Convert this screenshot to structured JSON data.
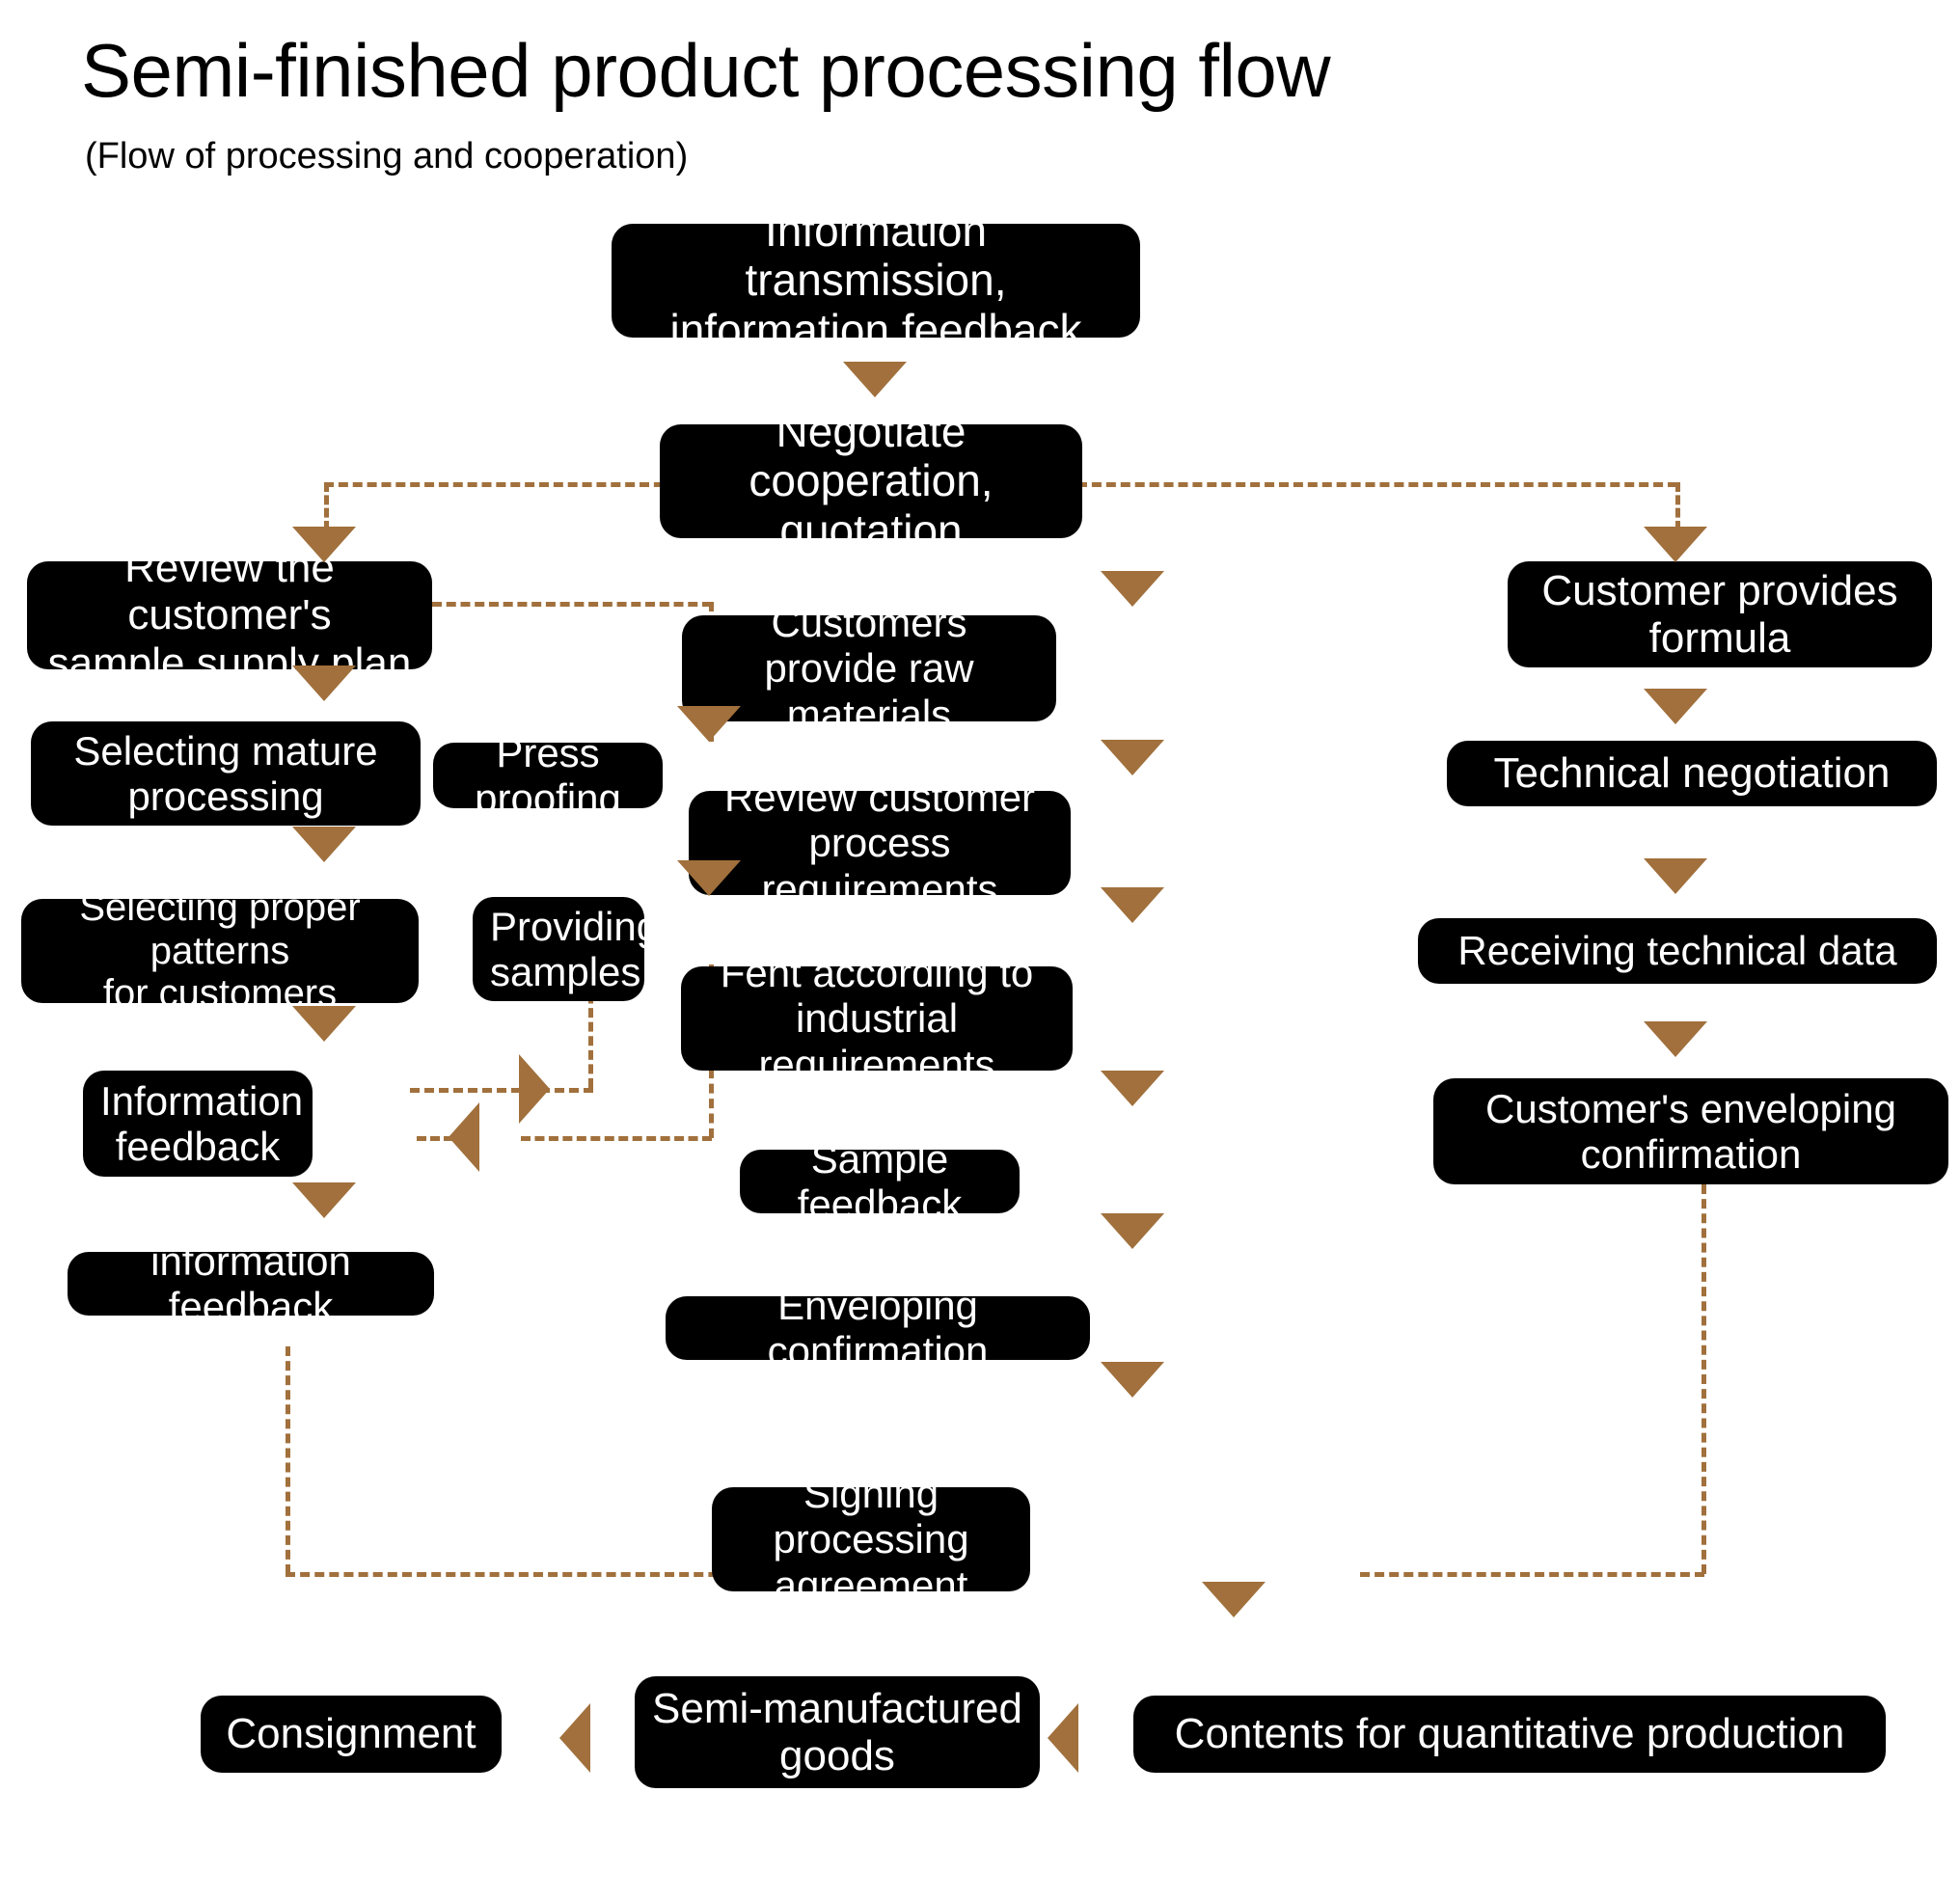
{
  "title": "Semi-finished product processing flow",
  "subtitle": "(Flow of processing and cooperation)",
  "colors": {
    "node_fill": "#000000",
    "node_text": "#ffffff",
    "connector": "#A1703C",
    "background": "#ffffff"
  },
  "nodes": {
    "info_transmission": "Information transmission,\ninformation feedback",
    "negotiate": "Negotiate cooperation,\nquotation",
    "customers_raw": "Customers\nprovide raw materials",
    "review_process": "Review customer\nprocess requirements",
    "fent": "Fent according to\nindustrial requirements",
    "sample_feedback": "Sample feedback",
    "enveloping_confirmation": "Enveloping confirmation",
    "signing": "Signing processing\nagreement",
    "review_sample_plan": "Review the customer's\nsample supply plan",
    "selecting_mature": "Selecting mature\nprocessing",
    "selecting_patterns": "Selecting proper patterns\nfor customers",
    "information_feedback_1": "Information\nfeedback",
    "information_feedback_2": "information feedback",
    "press_proofing": "Press proofing",
    "providing_samples": "Providing\nsamples",
    "customer_formula": "Customer provides\nformula",
    "technical_negotiation": "Technical negotiation",
    "receiving_data": "Receiving technical data",
    "customer_enveloping": "Customer's enveloping\nconfirmation",
    "contents_quantitative": "Contents for quantitative production",
    "semi_manufactured": "Semi-manufactured\ngoods",
    "consignment": "Consignment"
  },
  "chart_data": {
    "type": "flowchart",
    "title": "Semi-finished product processing flow",
    "subtitle": "(Flow of processing and cooperation)",
    "node_labels": [
      "Information transmission, information feedback",
      "Negotiate cooperation, quotation",
      "Review the customer's sample supply plan",
      "Customer provides formula",
      "Customers provide raw materials",
      "Selecting mature processing",
      "Press proofing",
      "Technical negotiation",
      "Review customer process requirements",
      "Selecting proper patterns for customers",
      "Providing samples",
      "Receiving technical data",
      "Fent according to industrial requirements",
      "Information feedback",
      "Customer's enveloping confirmation",
      "Sample feedback",
      "Enveloping confirmation",
      "information feedback",
      "Signing processing agreement",
      "Contents for quantitative production",
      "Semi-manufactured goods",
      "Consignment"
    ],
    "edges": [
      {
        "from": "Information transmission, information feedback",
        "to": "Negotiate cooperation, quotation",
        "style": "solid-arrow"
      },
      {
        "from": "Negotiate cooperation, quotation",
        "to": "Review the customer's sample supply plan",
        "style": "dashed-arrow"
      },
      {
        "from": "Negotiate cooperation, quotation",
        "to": "Customer provides formula",
        "style": "dashed-arrow"
      },
      {
        "from": "Negotiate cooperation, quotation",
        "to": "Customers provide raw materials",
        "style": "solid-arrow"
      },
      {
        "from": "Review the customer's sample supply plan",
        "to": "Selecting mature processing",
        "style": "solid-arrow"
      },
      {
        "from": "Review the customer's sample supply plan",
        "to": "Press proofing",
        "style": "dashed-arrow"
      },
      {
        "from": "Selecting mature processing",
        "to": "Selecting proper patterns for customers",
        "style": "solid-arrow"
      },
      {
        "from": "Selecting proper patterns for customers",
        "to": "Information feedback",
        "style": "solid-arrow"
      },
      {
        "from": "Press proofing",
        "to": "Providing samples",
        "style": "solid-arrow"
      },
      {
        "from": "Press proofing",
        "to": "Information feedback",
        "style": "dashed-arrow"
      },
      {
        "from": "Information feedback",
        "to": "Press proofing",
        "style": "dashed-arrow"
      },
      {
        "from": "Providing samples",
        "to": "Information feedback",
        "style": "dashed-arrow"
      },
      {
        "from": "Information feedback",
        "to": "information feedback",
        "style": "solid-arrow"
      },
      {
        "from": "information feedback",
        "to": "Signing processing agreement",
        "style": "dashed"
      },
      {
        "from": "Customers provide raw materials",
        "to": "Review customer process requirements",
        "style": "solid-arrow"
      },
      {
        "from": "Review customer process requirements",
        "to": "Fent according to industrial requirements",
        "style": "solid-arrow"
      },
      {
        "from": "Fent according to industrial requirements",
        "to": "Sample feedback",
        "style": "solid-arrow"
      },
      {
        "from": "Sample feedback",
        "to": "Enveloping confirmation",
        "style": "solid-arrow"
      },
      {
        "from": "Enveloping confirmation",
        "to": "Signing processing agreement",
        "style": "solid-arrow"
      },
      {
        "from": "Customer provides formula",
        "to": "Technical negotiation",
        "style": "solid-arrow"
      },
      {
        "from": "Technical negotiation",
        "to": "Receiving technical data",
        "style": "solid-arrow"
      },
      {
        "from": "Receiving technical data",
        "to": "Customer's enveloping confirmation",
        "style": "solid-arrow"
      },
      {
        "from": "Customer's enveloping confirmation",
        "to": "Signing processing agreement",
        "style": "dashed"
      },
      {
        "from": "Signing processing agreement",
        "to": "Contents for quantitative production",
        "style": "solid-arrow"
      },
      {
        "from": "Contents for quantitative production",
        "to": "Semi-manufactured goods",
        "style": "solid-arrow"
      },
      {
        "from": "Semi-manufactured goods",
        "to": "Consignment",
        "style": "solid-arrow"
      }
    ]
  }
}
